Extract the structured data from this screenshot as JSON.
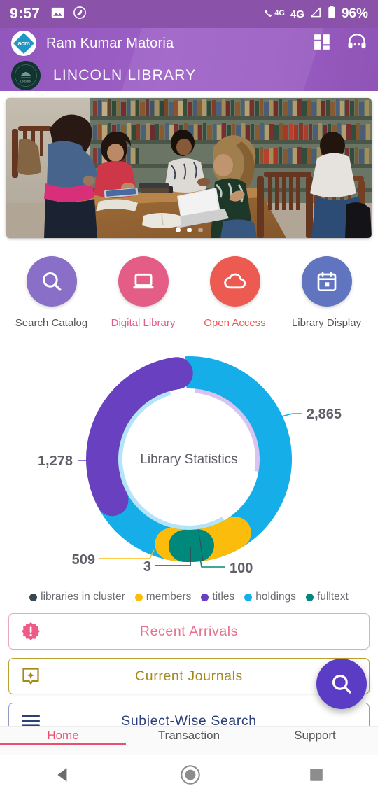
{
  "status_bar": {
    "time": "9:57",
    "icons": [
      "image-icon",
      "screenshot-icon"
    ],
    "network_sup": "4G",
    "network": "4G",
    "battery": "96%"
  },
  "app_bar": {
    "logo_text": "acm",
    "user_name": "Ram Kumar Matoria",
    "library_name": "LINCOLN LIBRARY",
    "seal_text": "LINCOLN",
    "icons": [
      "dashboard-grid-icon",
      "headset-support-icon"
    ]
  },
  "carousel": {
    "alt": "Students studying at a table in the library",
    "dots": 3,
    "active_dot": 1
  },
  "quick_actions": [
    {
      "label": "Search Catalog",
      "icon": "search-icon",
      "circle_color": "#8a6fc9",
      "label_color": "#55555c"
    },
    {
      "label": "Digital Library",
      "icon": "laptop-icon",
      "circle_color": "#e35d87",
      "label_color": "#e35d87"
    },
    {
      "label": "Open Access",
      "icon": "cloud-icon",
      "circle_color": "#ed5a52",
      "label_color": "#ed5a52"
    },
    {
      "label": "Library Display",
      "icon": "calendar-icon",
      "circle_color": "#6174c0",
      "label_color": "#55555c"
    }
  ],
  "chart_data": {
    "type": "pie",
    "title": "Library Statistics",
    "center_label": "Library Statistics",
    "categories": [
      "libraries in cluster",
      "members",
      "titles",
      "holdings",
      "fulltext"
    ],
    "values": [
      3,
      509,
      1278,
      2865,
      100
    ],
    "value_labels": [
      "3",
      "509",
      "1,278",
      "2,865",
      "100"
    ],
    "colors": [
      "#37474f",
      "#fbbc0b",
      "#6840c0",
      "#16aee8",
      "#00897b"
    ],
    "legend": [
      {
        "label": "libraries in cluster",
        "color": "#37474f"
      },
      {
        "label": "members",
        "color": "#fbbc0b"
      },
      {
        "label": "titles",
        "color": "#6840c0"
      },
      {
        "label": "holdings",
        "color": "#16aee8"
      },
      {
        "label": "fulltext",
        "color": "#00897b"
      }
    ],
    "legend_position": "bottom",
    "grid": false,
    "xlabel": "",
    "ylabel": ""
  },
  "action_cards": [
    {
      "label": "Recent Arrivals",
      "icon": "badge-alert-icon",
      "color": "#e8708f",
      "border": "#e8a9b9"
    },
    {
      "label": "Current Journals",
      "icon": "star-bookmark-icon",
      "color": "#a6881b",
      "border": "#bda032"
    },
    {
      "label": "Subject-Wise Search",
      "icon": "menu-lines-icon",
      "color": "#2b3f7a",
      "border": "#8f9bc0"
    }
  ],
  "fab": {
    "icon": "search-icon",
    "color": "#5b3cc4"
  },
  "bottom_tabs": [
    {
      "label": "Home",
      "active": true
    },
    {
      "label": "Transaction",
      "active": false
    },
    {
      "label": "Support",
      "active": false
    }
  ],
  "android_nav": [
    "back-icon",
    "home-icon",
    "recents-icon"
  ]
}
